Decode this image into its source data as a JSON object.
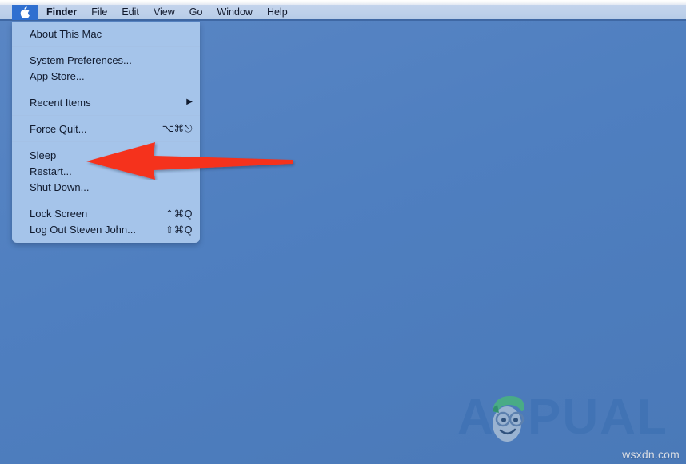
{
  "menubar": {
    "apple_icon": "apple-logo-icon",
    "items": [
      {
        "label": "Finder",
        "bold": true
      },
      {
        "label": "File",
        "bold": false
      },
      {
        "label": "Edit",
        "bold": false
      },
      {
        "label": "View",
        "bold": false
      },
      {
        "label": "Go",
        "bold": false
      },
      {
        "label": "Window",
        "bold": false
      },
      {
        "label": "Help",
        "bold": false
      }
    ]
  },
  "apple_menu": {
    "groups": [
      {
        "rows": [
          {
            "label": "About This Mac",
            "shortcut": "",
            "submenu": false
          }
        ]
      },
      {
        "rows": [
          {
            "label": "System Preferences...",
            "shortcut": "",
            "submenu": false
          },
          {
            "label": "App Store...",
            "shortcut": "",
            "submenu": false
          }
        ]
      },
      {
        "rows": [
          {
            "label": "Recent Items",
            "shortcut": "",
            "submenu": true,
            "submenu_glyph": "▶"
          }
        ]
      },
      {
        "rows": [
          {
            "label": "Force Quit...",
            "shortcut": "⌥⌘⎋",
            "submenu": false
          }
        ]
      },
      {
        "rows": [
          {
            "label": "Sleep",
            "shortcut": "",
            "submenu": false
          },
          {
            "label": "Restart...",
            "shortcut": "",
            "submenu": false
          },
          {
            "label": "Shut Down...",
            "shortcut": "",
            "submenu": false
          }
        ]
      },
      {
        "rows": [
          {
            "label": "Lock Screen",
            "shortcut": "⌃⌘Q",
            "submenu": false
          },
          {
            "label": "Log Out Steven John...",
            "shortcut": "⇧⌘Q",
            "submenu": false
          }
        ]
      }
    ]
  },
  "annotation": {
    "arrow_name": "red-pointer-arrow",
    "arrow_color": "#f5321e",
    "points_to": "Restart..."
  },
  "watermark": {
    "text": "APPUALS",
    "mascot": "appuals-mascot-icon",
    "logo_color": "#3f72b4",
    "hair_color": "#49b47e"
  },
  "footer": {
    "site_credit": "wsxdn.com"
  },
  "colors": {
    "desktop": "#5180c0",
    "menubar": "#bdd0ea",
    "menu_panel": "#a5c4ea",
    "apple_highlight": "#2f6fd0",
    "text": "#101a2e",
    "arrow": "#f5321e"
  }
}
